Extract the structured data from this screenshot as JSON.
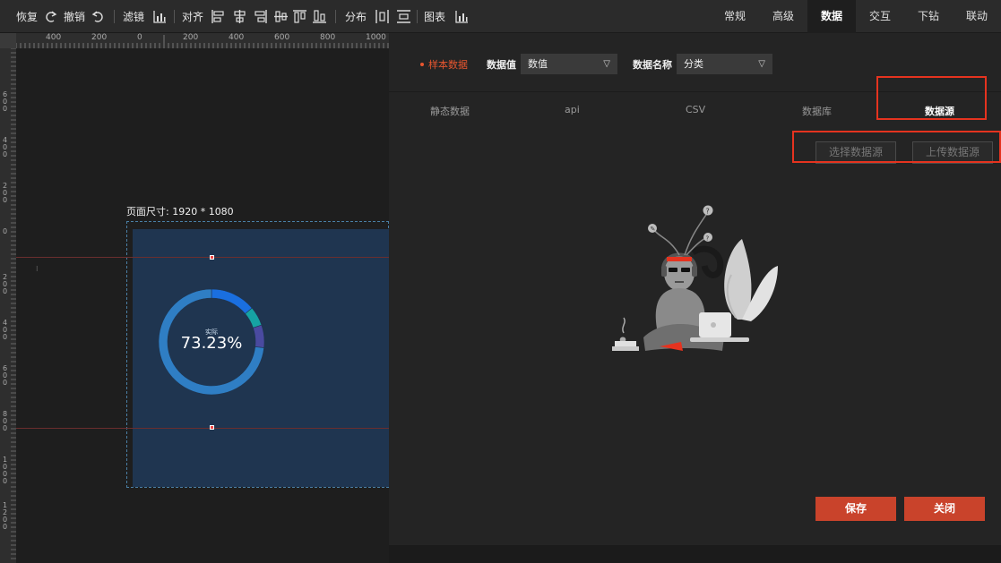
{
  "toolbar": {
    "restore": "恢复",
    "undo": "撤销",
    "filter": "滤镜",
    "align": "对齐",
    "distribute": "分布",
    "chart": "图表"
  },
  "tabs": [
    "常规",
    "高级",
    "数据",
    "交互",
    "下钻",
    "联动"
  ],
  "active_tab": "数据",
  "ruler_top": [
    "400",
    "200",
    "0",
    "200",
    "400",
    "600",
    "800",
    "1000"
  ],
  "ruler_left": [
    "600",
    "400",
    "200",
    "0",
    "200",
    "400",
    "600",
    "800",
    "1000",
    "1200"
  ],
  "canvas": {
    "page_size_label": "页面尺寸: 1920 * 1080",
    "donut_label": "实际",
    "donut_value": "73.23%",
    "donut_fraction": 0.7323
  },
  "panel": {
    "sample_label": "样本数据",
    "value_label": "数据值",
    "value_select": "数值",
    "name_label": "数据名称",
    "name_select": "分类",
    "subtabs": [
      "静态数据",
      "api",
      "CSV",
      "数据库",
      "数据源"
    ],
    "active_subtab": "数据源",
    "select_source_button": "选择数据源",
    "upload_source_button": "上传数据源",
    "save_button": "保存",
    "close_button": "关闭"
  },
  "colors": {
    "accent": "#c9432b",
    "highlight": "#e5331f",
    "donut_main": "#2f7ec4",
    "donut_blue": "#1a6fe0",
    "donut_teal": "#16a3a3",
    "donut_purple": "#4a4aa0"
  }
}
